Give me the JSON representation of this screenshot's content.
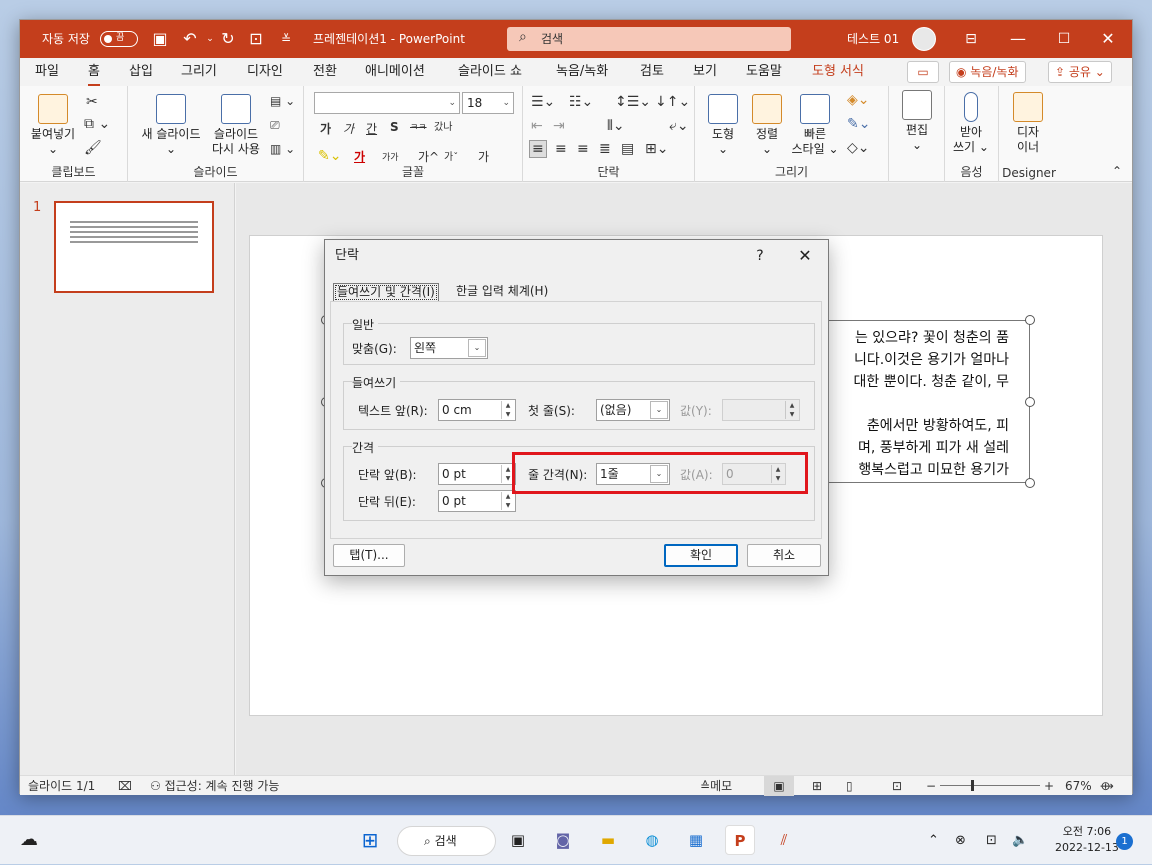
{
  "titlebar": {
    "autosave_label": "자동 저장",
    "autosave_state": "끔",
    "doc_title": "프레젠테이션1 - PowerPoint",
    "search_placeholder": "검색",
    "user_name": "테스트 01",
    "accent_color": "#c43e1c"
  },
  "tabs": [
    "파일",
    "홈",
    "삽입",
    "그리기",
    "디자인",
    "전환",
    "애니메이션",
    "슬라이드 쇼",
    "녹음/녹화",
    "검토",
    "보기",
    "도움말",
    "도형 서식"
  ],
  "tab_buttons": {
    "record": "녹음/녹화",
    "share": "공유"
  },
  "ribbon": {
    "clipboard": {
      "paste": "붙여넣기",
      "label": "클립보드"
    },
    "slides": {
      "new_slide": "새 슬라이드",
      "reuse_line1": "슬라이드",
      "reuse_line2": "다시 사용",
      "label": "슬라이드"
    },
    "font": {
      "font_size": "18",
      "label": "글꼴",
      "row2": [
        "가",
        "가",
        "간",
        "S",
        "ㅋㅋ",
        "갔나"
      ],
      "row3": [
        "가",
        "가가",
        "가^",
        "가ˇ",
        "가"
      ]
    },
    "paragraph": {
      "label": "단락"
    },
    "drawing": {
      "shape": "도형",
      "arrange": "정렬",
      "quick_line1": "빠른",
      "quick_line2": "스타일",
      "label": "그리기"
    },
    "editing": {
      "edit": "편집"
    },
    "voice": {
      "dictate_line1": "받아",
      "dictate_line2": "쓰기",
      "label": "음성"
    },
    "designer": {
      "line1": "디자",
      "line2": "이너",
      "label": "Designer"
    }
  },
  "thumbnail": {
    "number": "1"
  },
  "slide_text": [
    "는 있으랴? 꽃이 청춘의 품",
    "니다.이것은 용기가 얼마나",
    "대한 뿐이다. 청춘 같이, 무",
    "",
    "춘에서만 방황하여도, 피",
    "며, 풍부하게 피가 새 설레",
    "행복스럽고 미묘한 용기가"
  ],
  "dialog": {
    "title": "단락",
    "help": "?",
    "close": "✕",
    "tab_indent": "들여쓰기 및 간격(I)",
    "tab_hangul": "한글 입력 체계(H)",
    "general": {
      "legend": "일반",
      "align_label": "맞춤(G):",
      "align_value": "왼쪽"
    },
    "indent": {
      "legend": "들여쓰기",
      "before_label": "텍스트 앞(R):",
      "before_value": "0 cm",
      "first_label": "첫 줄(S):",
      "first_value": "(없음)",
      "by_label": "값(Y):",
      "by_value": ""
    },
    "spacing": {
      "legend": "간격",
      "before_label": "단락 앞(B):",
      "before_value": "0 pt",
      "after_label": "단락 뒤(E):",
      "after_value": "0 pt",
      "line_label": "줄 간격(N):",
      "line_value": "1줄",
      "at_label": "값(A):",
      "at_value": "0"
    },
    "tabs_button": "탭(T)...",
    "ok": "확인",
    "cancel": "취소",
    "highlight_color": "#e0161c"
  },
  "status": {
    "slide": "슬라이드 1/1",
    "accessibility": "접근성: 계속 진행 가능",
    "notes": "메모",
    "zoom": "67%"
  },
  "taskbar": {
    "search": "검색",
    "time": "오전 7:06",
    "date": "2022-12-13",
    "badge": "1"
  }
}
